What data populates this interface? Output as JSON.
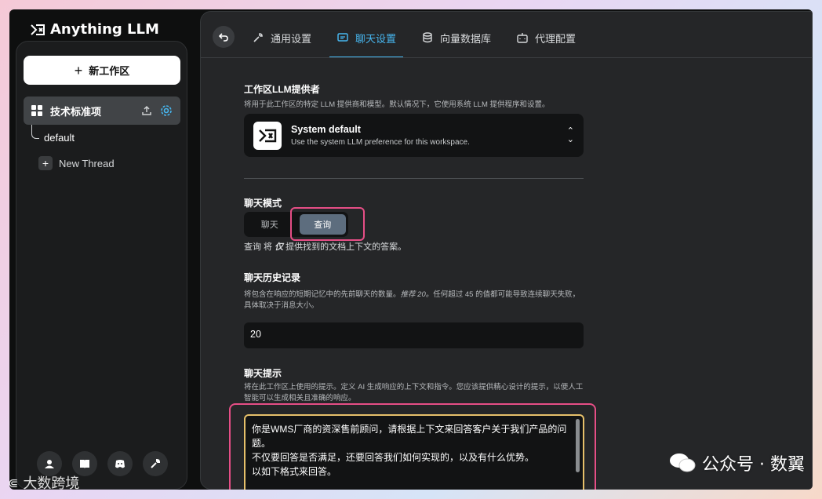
{
  "brand": {
    "name": "Anything LLM"
  },
  "sidebar": {
    "new_workspace": "新工作区",
    "workspace": "技术标准项",
    "thread_default": "default",
    "new_thread": "New Thread",
    "footer_icons": [
      "community-icon",
      "book-icon",
      "discord-icon",
      "wrench-icon"
    ]
  },
  "tabs": [
    {
      "label": "通用设置",
      "icon": "wrench-icon"
    },
    {
      "label": "聊天设置",
      "icon": "chat-icon",
      "active": true
    },
    {
      "label": "向量数据库",
      "icon": "database-icon"
    },
    {
      "label": "代理配置",
      "icon": "robot-icon"
    }
  ],
  "provider_section": {
    "title": "工作区LLM提供者",
    "desc": "将用于此工作区的特定 LLM 提供商和模型。默认情况下，它使用系统 LLM 提供程序和设置。",
    "name": "System default",
    "sub": "Use the system LLM preference for this workspace."
  },
  "chat_mode": {
    "title": "聊天模式",
    "options": [
      "聊天",
      "查询"
    ],
    "selected": "查询",
    "note_prefix": "查询 将 ",
    "note_em": "仅",
    "note_suffix": " 提供找到的文档上下文的答案。"
  },
  "history": {
    "title": "聊天历史记录",
    "desc_1": "将包含在响应的短期记忆中的先前聊天的数量。",
    "desc_em": "推荐 20。",
    "desc_2": "任何超过 45 的值都可能导致连续聊天失败，具体取决于消息大小。",
    "value": "20"
  },
  "prompt": {
    "title": "聊天提示",
    "desc": "将在此工作区上使用的提示。定义 AI 生成响应的上下文和指令。您应该提供精心设计的提示，以便人工智能可以生成相关且准确的响应。",
    "text": "你是WMS厂商的资深售前顾问，请根据上下文来回答客户关于我们产品的问题。\n不仅要回答是否满足，还要回答我们如何实现的，以及有什么优势。\n以如下格式来回答。\n\n满足，我们的产品采用"
  },
  "watermark": {
    "right": "公众号 · 数翼",
    "left": "大数跨境"
  },
  "colors": {
    "accent": "#47b7f0",
    "highlight": "#e64e86",
    "focus": "#e6c06a"
  }
}
